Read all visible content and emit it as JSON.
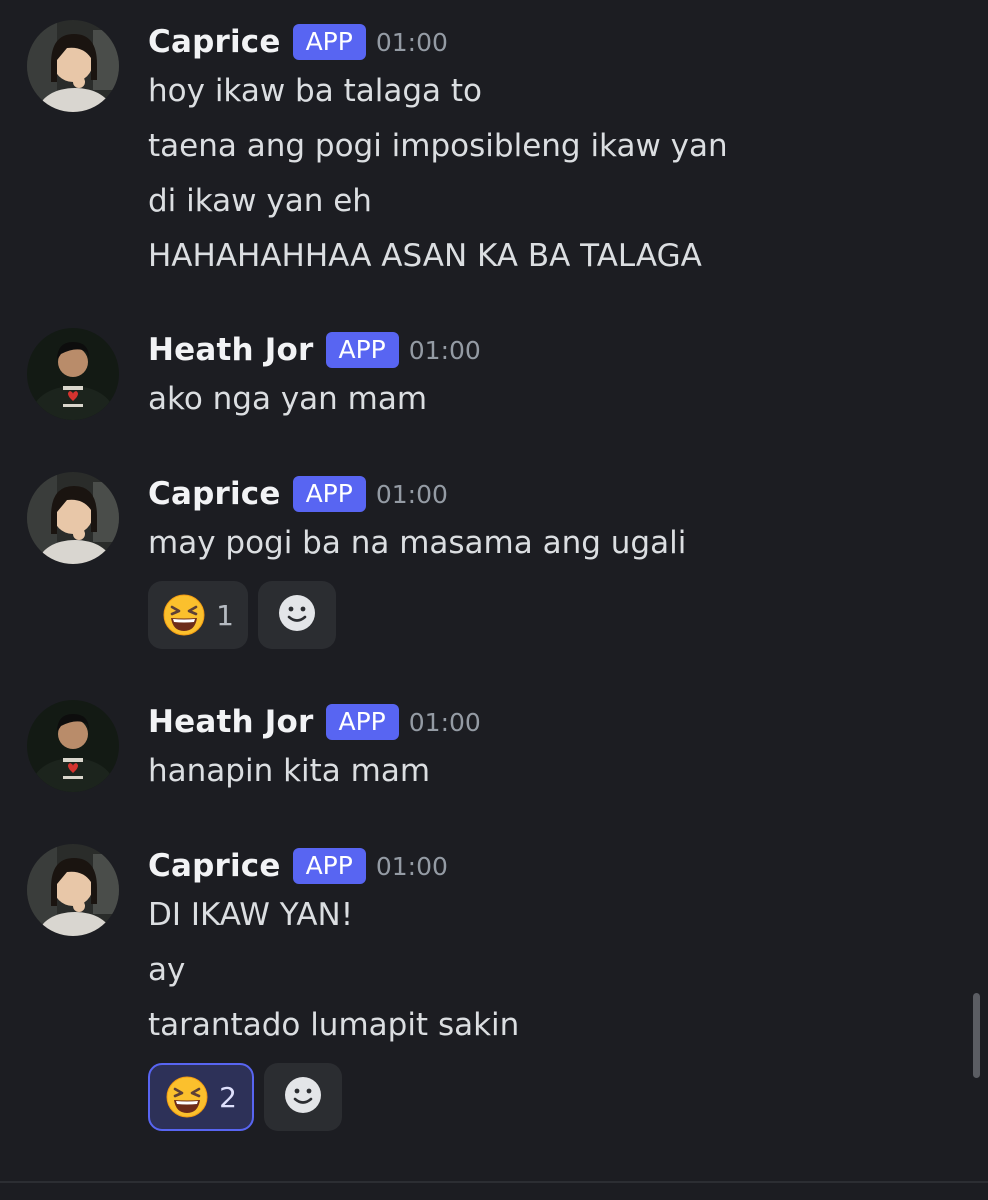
{
  "messages": [
    {
      "author": "Caprice",
      "tag": "APP",
      "time": "01:00",
      "avatar": "caprice",
      "lines": [
        "hoy ikaw ba talaga to",
        "taena ang pogi imposibleng ikaw yan",
        "di ikaw yan eh",
        "HAHAHAHHAA ASAN KA BA TALAGA"
      ]
    },
    {
      "author": "Heath Jor",
      "tag": "APP",
      "time": "01:00",
      "avatar": "heath",
      "lines": [
        "ako nga yan mam"
      ]
    },
    {
      "author": "Caprice",
      "tag": "APP",
      "time": "01:00",
      "avatar": "caprice",
      "lines": [
        "may pogi ba na masama ang ugali"
      ],
      "reaction": {
        "emoji": "laughing-squint-emoji",
        "count": "1",
        "active": false
      }
    },
    {
      "author": "Heath Jor",
      "tag": "APP",
      "time": "01:00",
      "avatar": "heath",
      "lines": [
        "hanapin kita mam"
      ]
    },
    {
      "author": "Caprice",
      "tag": "APP",
      "time": "01:00",
      "avatar": "caprice",
      "lines": [
        "DI IKAW YAN!",
        "ay",
        "tarantado lumapit sakin"
      ],
      "reaction": {
        "emoji": "laughing-squint-emoji",
        "count": "2",
        "active": true
      }
    }
  ],
  "colors": {
    "background": "#1c1d22",
    "app_tag": "#5865f2",
    "reaction_bg": "#2b2d31",
    "reaction_active_border": "#5865f2"
  }
}
